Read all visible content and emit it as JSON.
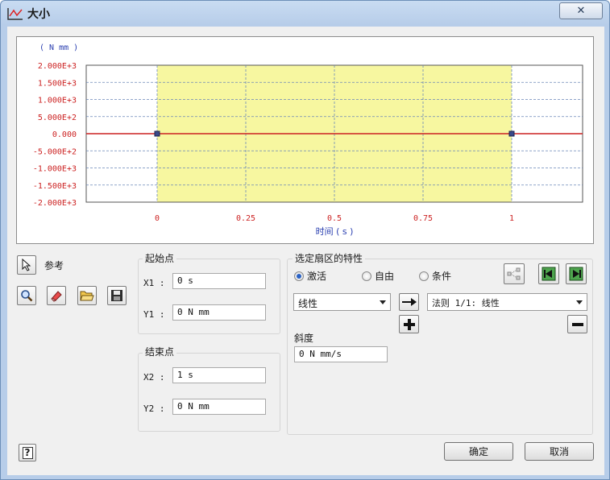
{
  "window": {
    "title": "大小",
    "close_label": "✕"
  },
  "chart_data": {
    "type": "line",
    "title": "",
    "y_unit_label": "( N mm )",
    "xlabel": "时间 ( s )",
    "x_ticks": [
      "0",
      "0.25",
      "0.5",
      "0.75",
      "1"
    ],
    "x_tick_values": [
      0,
      0.25,
      0.5,
      0.75,
      1
    ],
    "y_ticks": [
      "2.000E+3",
      "1.500E+3",
      "1.000E+3",
      "5.000E+2",
      "0.000",
      "-5.000E+2",
      "-1.000E+3",
      "-1.500E+3",
      "-2.000E+3"
    ],
    "y_tick_values": [
      2000,
      1500,
      1000,
      500,
      0,
      -500,
      -1000,
      -1500,
      -2000
    ],
    "xlim": [
      -0.2,
      1.2
    ],
    "ylim": [
      -2000,
      2000
    ],
    "grid": true,
    "highlight_region": [
      0,
      1
    ],
    "highlight_color": "#f7f7a0",
    "series": [
      {
        "x": [
          -0.2,
          0,
          1,
          1.2
        ],
        "y": [
          0,
          0,
          0,
          0
        ],
        "color": "#cc2222"
      }
    ],
    "markers": [
      {
        "x": 0,
        "y": 0
      },
      {
        "x": 1,
        "y": 0
      }
    ],
    "tick_color": "#cc2222"
  },
  "reference": {
    "label": "参考"
  },
  "start": {
    "title": "起始点",
    "x_label": "X1 :",
    "x_value": "0 s",
    "y_label": "Y1 :",
    "y_value": "0 N mm"
  },
  "end": {
    "title": "结束点",
    "x_label": "X2 :",
    "x_value": "1 s",
    "y_label": "Y2 :",
    "y_value": "0 N mm"
  },
  "sector": {
    "title": "选定扇区的特性",
    "radio_active": "激活",
    "radio_free": "自由",
    "radio_condition": "条件",
    "type_select": "线性",
    "law_select": "法则 1/1: 线性",
    "slope_label": "斜度",
    "slope_value": "0 N mm/s"
  },
  "buttons": {
    "ok": "确定",
    "cancel": "取消",
    "help": "?"
  }
}
